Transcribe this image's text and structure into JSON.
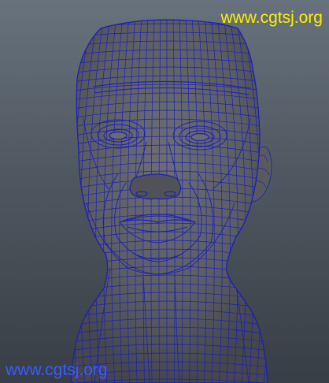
{
  "viewport": {
    "background_top": "#68727c",
    "background_bottom": "#383e45"
  },
  "model": {
    "subject": "head-polygon-mesh",
    "fill_color": "#5b5d62",
    "wireframe_color": "#1a1fb8"
  },
  "watermarks": {
    "top_right": {
      "text": "www.cgtsj.org",
      "color": "#ffee00"
    },
    "bottom_left": {
      "text": "www.cgtsj.org",
      "color": "#3a5cff"
    }
  }
}
